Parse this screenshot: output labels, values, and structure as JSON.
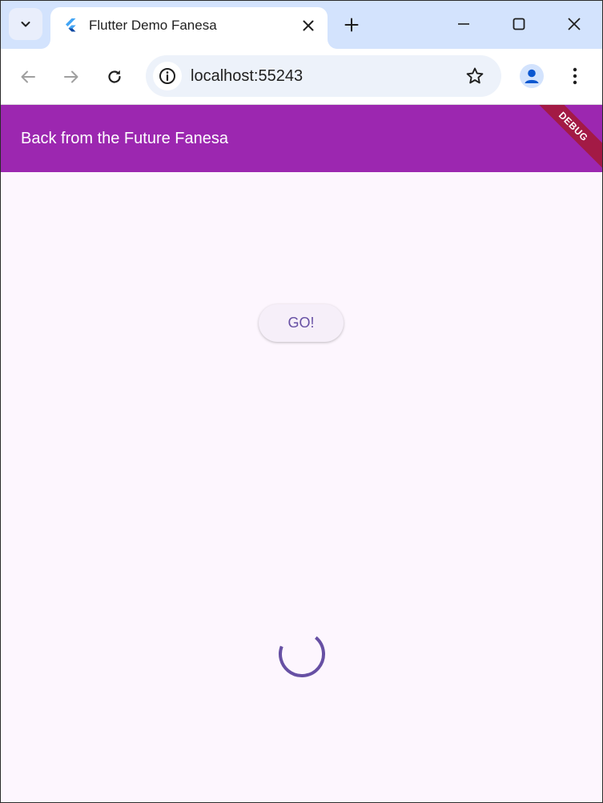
{
  "browser": {
    "tab": {
      "title": "Flutter Demo Fanesa",
      "favicon": "flutter-logo-icon"
    },
    "address_bar": {
      "url": "localhost:55243"
    },
    "icons": {
      "tab_search": "chevron-down-icon",
      "close_tab": "close-icon",
      "new_tab": "plus-icon",
      "minimize": "minimize-icon",
      "maximize": "maximize-icon",
      "close_window": "close-icon",
      "back": "arrow-left-icon",
      "forward": "arrow-right-icon",
      "reload": "reload-icon",
      "site_info": "info-icon",
      "bookmark": "star-icon",
      "profile": "person-icon",
      "menu": "more-vert-icon"
    }
  },
  "app": {
    "appbar": {
      "title": "Back from the Future Fanesa",
      "color": "#9c27b0"
    },
    "debug_banner": "DEBUG",
    "go_button_label": "GO!",
    "accent_color": "#6750a4",
    "background_color": "#fdf6fe",
    "loading": true
  }
}
